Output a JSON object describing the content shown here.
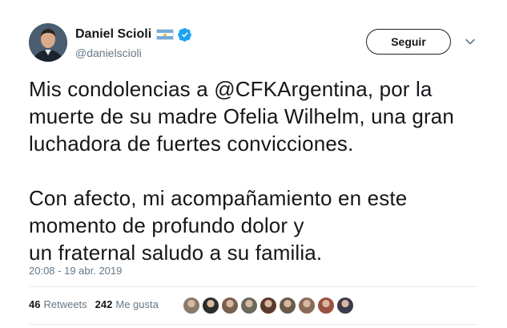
{
  "user": {
    "name": "Daniel Scioli",
    "handle": "@danielscioli",
    "flag_icon": "argentina-flag-icon",
    "verified_icon": "verified-badge-icon"
  },
  "follow_button": {
    "label": "Seguir"
  },
  "tweet": {
    "text": "Mis condolencias a @CFKArgentina, por la\nmuerte de su madre Ofelia Wilhelm, una gran\nluchadora de fuertes convicciones.\n\nCon afecto, mi acompañamiento en este\nmomento de profundo dolor y\nun fraternal saludo a su familia.",
    "timestamp": "20:08 - 19 abr. 2019"
  },
  "stats": {
    "retweets_count": "46",
    "retweets_label": "Retweets",
    "likes_count": "242",
    "likes_label": "Me gusta"
  },
  "colors": {
    "text": "#14171a",
    "secondary": "#657786",
    "verified_blue": "#1da1f2",
    "divider": "#e6ecf0"
  },
  "liker_avatars": [
    {
      "color": "#8a7a6a"
    },
    {
      "color": "#2c2c2c"
    },
    {
      "color": "#7a6050"
    },
    {
      "color": "#6a6a5a"
    },
    {
      "color": "#5a3a2a"
    },
    {
      "color": "#6a5a4a"
    },
    {
      "color": "#8a6a5a"
    },
    {
      "color": "#9a5040"
    },
    {
      "color": "#3a3a4a"
    }
  ]
}
